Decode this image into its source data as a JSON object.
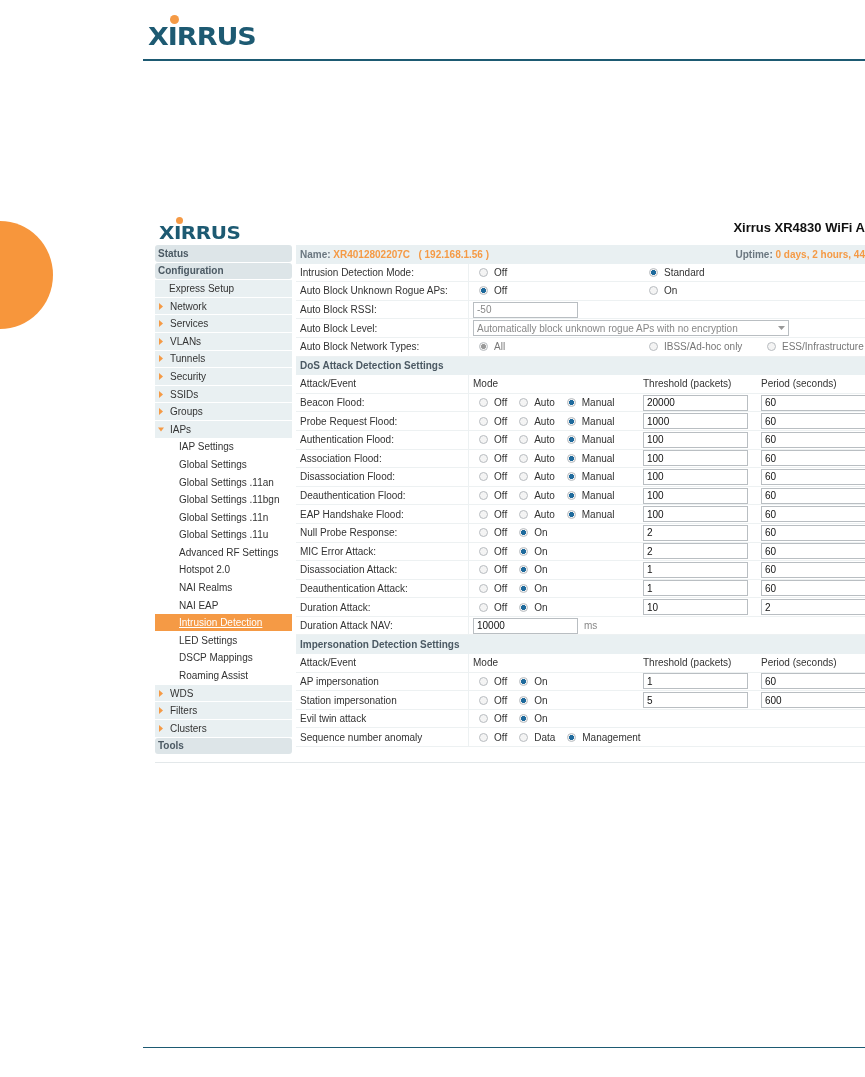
{
  "page": {
    "logo": "XIRRUS"
  },
  "app": {
    "logo": "XIRRUS",
    "title": "Xirrus XR4830 WiFi A"
  },
  "sidebar": {
    "items": [
      {
        "label": "Status",
        "kind": "section",
        "selected": false
      },
      {
        "label": "Configuration",
        "kind": "section",
        "selected": false
      },
      {
        "label": "Express Setup",
        "kind": "link",
        "selected": false
      },
      {
        "label": "Network",
        "kind": "group",
        "expanded": false,
        "selected": false
      },
      {
        "label": "Services",
        "kind": "group",
        "expanded": false,
        "selected": false
      },
      {
        "label": "VLANs",
        "kind": "group",
        "expanded": false,
        "selected": false
      },
      {
        "label": "Tunnels",
        "kind": "group",
        "expanded": false,
        "selected": false
      },
      {
        "label": "Security",
        "kind": "group",
        "expanded": false,
        "selected": false
      },
      {
        "label": "SSIDs",
        "kind": "group",
        "expanded": false,
        "selected": false
      },
      {
        "label": "Groups",
        "kind": "group",
        "expanded": false,
        "selected": false
      },
      {
        "label": "IAPs",
        "kind": "group",
        "expanded": true,
        "selected": false,
        "children": [
          {
            "label": "IAP Settings",
            "selected": false
          },
          {
            "label": "Global Settings",
            "selected": false
          },
          {
            "label": "Global Settings .11an",
            "selected": false
          },
          {
            "label": "Global Settings .11bgn",
            "selected": false
          },
          {
            "label": "Global Settings .11n",
            "selected": false
          },
          {
            "label": "Global Settings .11u",
            "selected": false
          },
          {
            "label": "Advanced RF Settings",
            "selected": false
          },
          {
            "label": "Hotspot 2.0",
            "selected": false
          },
          {
            "label": "NAI Realms",
            "selected": false
          },
          {
            "label": "NAI EAP",
            "selected": false
          },
          {
            "label": "Intrusion Detection",
            "selected": true
          },
          {
            "label": "LED Settings",
            "selected": false
          },
          {
            "label": "DSCP Mappings",
            "selected": false
          },
          {
            "label": "Roaming Assist",
            "selected": false
          }
        ]
      },
      {
        "label": "WDS",
        "kind": "group",
        "expanded": false,
        "selected": false
      },
      {
        "label": "Filters",
        "kind": "group",
        "expanded": false,
        "selected": false
      },
      {
        "label": "Clusters",
        "kind": "group",
        "expanded": false,
        "selected": false
      },
      {
        "label": "Tools",
        "kind": "section",
        "selected": false
      }
    ]
  },
  "status_bar": {
    "name_label": "Name:",
    "name": "XR4012802207C",
    "ip": "( 192.168.1.56 )",
    "uptime_label": "Uptime:",
    "uptime": "0 days, 2 hours, 44"
  },
  "settings": [
    {
      "label": "Intrusion Detection Mode:",
      "kind": "radio",
      "disabled": false,
      "options": [
        {
          "label": "Off",
          "selected": false
        },
        {
          "label": "Standard",
          "selected": true
        }
      ]
    },
    {
      "label": "Auto Block Unknown Rogue APs:",
      "kind": "radio",
      "disabled": false,
      "options": [
        {
          "label": "Off",
          "selected": true
        },
        {
          "label": "On",
          "selected": false
        }
      ]
    },
    {
      "label": "Auto Block RSSI:",
      "kind": "input",
      "disabled": true,
      "value": "-50"
    },
    {
      "label": "Auto Block Level:",
      "kind": "select",
      "disabled": true,
      "value": "Automatically block unknown rogue APs with no encryption"
    },
    {
      "label": "Auto Block Network Types:",
      "kind": "radio",
      "disabled": true,
      "options": [
        {
          "label": "All",
          "selected": true
        },
        {
          "label": "IBSS/Ad-hoc only",
          "selected": false
        },
        {
          "label": "ESS/Infrastructure",
          "selected": false
        }
      ]
    }
  ],
  "dos": {
    "title": "DoS Attack Detection Settings",
    "columns": [
      "Attack/Event",
      "Mode",
      "Threshold (packets)",
      "Period (seconds)"
    ],
    "rows": [
      {
        "label": "Beacon Flood:",
        "kind": "mode",
        "options": [
          {
            "label": "Off",
            "selected": false
          },
          {
            "label": "Auto",
            "selected": false
          },
          {
            "label": "Manual",
            "selected": true
          }
        ],
        "threshold": "20000",
        "period": "60"
      },
      {
        "label": "Probe Request Flood:",
        "kind": "mode",
        "options": [
          {
            "label": "Off",
            "selected": false
          },
          {
            "label": "Auto",
            "selected": false
          },
          {
            "label": "Manual",
            "selected": true
          }
        ],
        "threshold": "1000",
        "period": "60"
      },
      {
        "label": "Authentication Flood:",
        "kind": "mode",
        "options": [
          {
            "label": "Off",
            "selected": false
          },
          {
            "label": "Auto",
            "selected": false
          },
          {
            "label": "Manual",
            "selected": true
          }
        ],
        "threshold": "100",
        "period": "60"
      },
      {
        "label": "Association Flood:",
        "kind": "mode",
        "options": [
          {
            "label": "Off",
            "selected": false
          },
          {
            "label": "Auto",
            "selected": false
          },
          {
            "label": "Manual",
            "selected": true
          }
        ],
        "threshold": "100",
        "period": "60"
      },
      {
        "label": "Disassociation Flood:",
        "kind": "mode",
        "options": [
          {
            "label": "Off",
            "selected": false
          },
          {
            "label": "Auto",
            "selected": false
          },
          {
            "label": "Manual",
            "selected": true
          }
        ],
        "threshold": "100",
        "period": "60"
      },
      {
        "label": "Deauthentication Flood:",
        "kind": "mode",
        "options": [
          {
            "label": "Off",
            "selected": false
          },
          {
            "label": "Auto",
            "selected": false
          },
          {
            "label": "Manual",
            "selected": true
          }
        ],
        "threshold": "100",
        "period": "60"
      },
      {
        "label": "EAP Handshake Flood:",
        "kind": "mode",
        "options": [
          {
            "label": "Off",
            "selected": false
          },
          {
            "label": "Auto",
            "selected": false
          },
          {
            "label": "Manual",
            "selected": true
          }
        ],
        "threshold": "100",
        "period": "60"
      },
      {
        "label": "Null Probe Response:",
        "kind": "mode",
        "options": [
          {
            "label": "Off",
            "selected": false
          },
          {
            "label": "On",
            "selected": true
          }
        ],
        "threshold": "2",
        "period": "60"
      },
      {
        "label": "MIC Error Attack:",
        "kind": "mode",
        "options": [
          {
            "label": "Off",
            "selected": false
          },
          {
            "label": "On",
            "selected": true
          }
        ],
        "threshold": "2",
        "period": "60"
      },
      {
        "label": "Disassociation Attack:",
        "kind": "mode",
        "options": [
          {
            "label": "Off",
            "selected": false
          },
          {
            "label": "On",
            "selected": true
          }
        ],
        "threshold": "1",
        "period": "60"
      },
      {
        "label": "Deauthentication Attack:",
        "kind": "mode",
        "options": [
          {
            "label": "Off",
            "selected": false
          },
          {
            "label": "On",
            "selected": true
          }
        ],
        "threshold": "1",
        "period": "60"
      },
      {
        "label": "Duration Attack:",
        "kind": "mode",
        "options": [
          {
            "label": "Off",
            "selected": false
          },
          {
            "label": "On",
            "selected": true
          }
        ],
        "threshold": "10",
        "period": "2"
      },
      {
        "label": "Duration Attack NAV:",
        "kind": "value",
        "value": "10000",
        "unit": "ms"
      }
    ]
  },
  "impersonation": {
    "title": "Impersonation Detection Settings",
    "columns": [
      "Attack/Event",
      "Mode",
      "Threshold (packets)",
      "Period (seconds)"
    ],
    "rows": [
      {
        "label": "AP impersonation",
        "kind": "mode",
        "options": [
          {
            "label": "Off",
            "selected": false
          },
          {
            "label": "On",
            "selected": true
          }
        ],
        "threshold": "1",
        "period": "60"
      },
      {
        "label": "Station impersonation",
        "kind": "mode",
        "options": [
          {
            "label": "Off",
            "selected": false
          },
          {
            "label": "On",
            "selected": true
          }
        ],
        "threshold": "5",
        "period": "600"
      },
      {
        "label": "Evil twin attack",
        "kind": "mode",
        "options": [
          {
            "label": "Off",
            "selected": false
          },
          {
            "label": "On",
            "selected": true
          }
        ]
      },
      {
        "label": "Sequence number anomaly",
        "kind": "mode",
        "options": [
          {
            "label": "Off",
            "selected": false
          },
          {
            "label": "Data",
            "selected": false
          },
          {
            "label": "Management",
            "selected": true
          }
        ]
      }
    ]
  }
}
